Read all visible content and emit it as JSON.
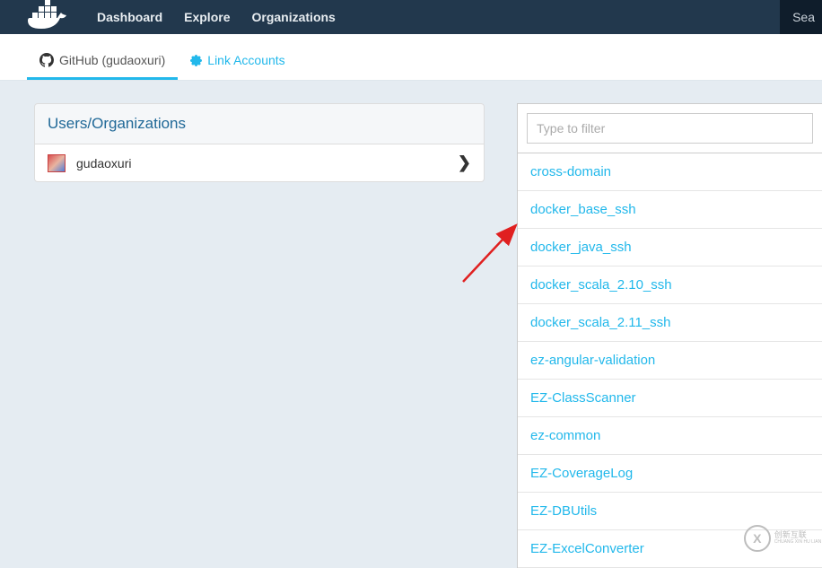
{
  "nav": {
    "dashboard": "Dashboard",
    "explore": "Explore",
    "organizations": "Organizations",
    "search_partial": "Sea"
  },
  "tabs": {
    "github": "GitHub (gudaoxuri)",
    "link_accounts": "Link Accounts"
  },
  "left_panel": {
    "header": "Users/Organizations",
    "username": "gudaoxuri"
  },
  "filter": {
    "placeholder": "Type to filter"
  },
  "repos": [
    "cross-domain",
    "docker_base_ssh",
    "docker_java_ssh",
    "docker_scala_2.10_ssh",
    "docker_scala_2.11_ssh",
    "ez-angular-validation",
    "EZ-ClassScanner",
    "ez-common",
    "EZ-CoverageLog",
    "EZ-DBUtils",
    "EZ-ExcelConverter"
  ],
  "watermark": {
    "symbol": "X",
    "line1": "创新互联",
    "line2": "CHUANG XIN HU LIAN"
  }
}
